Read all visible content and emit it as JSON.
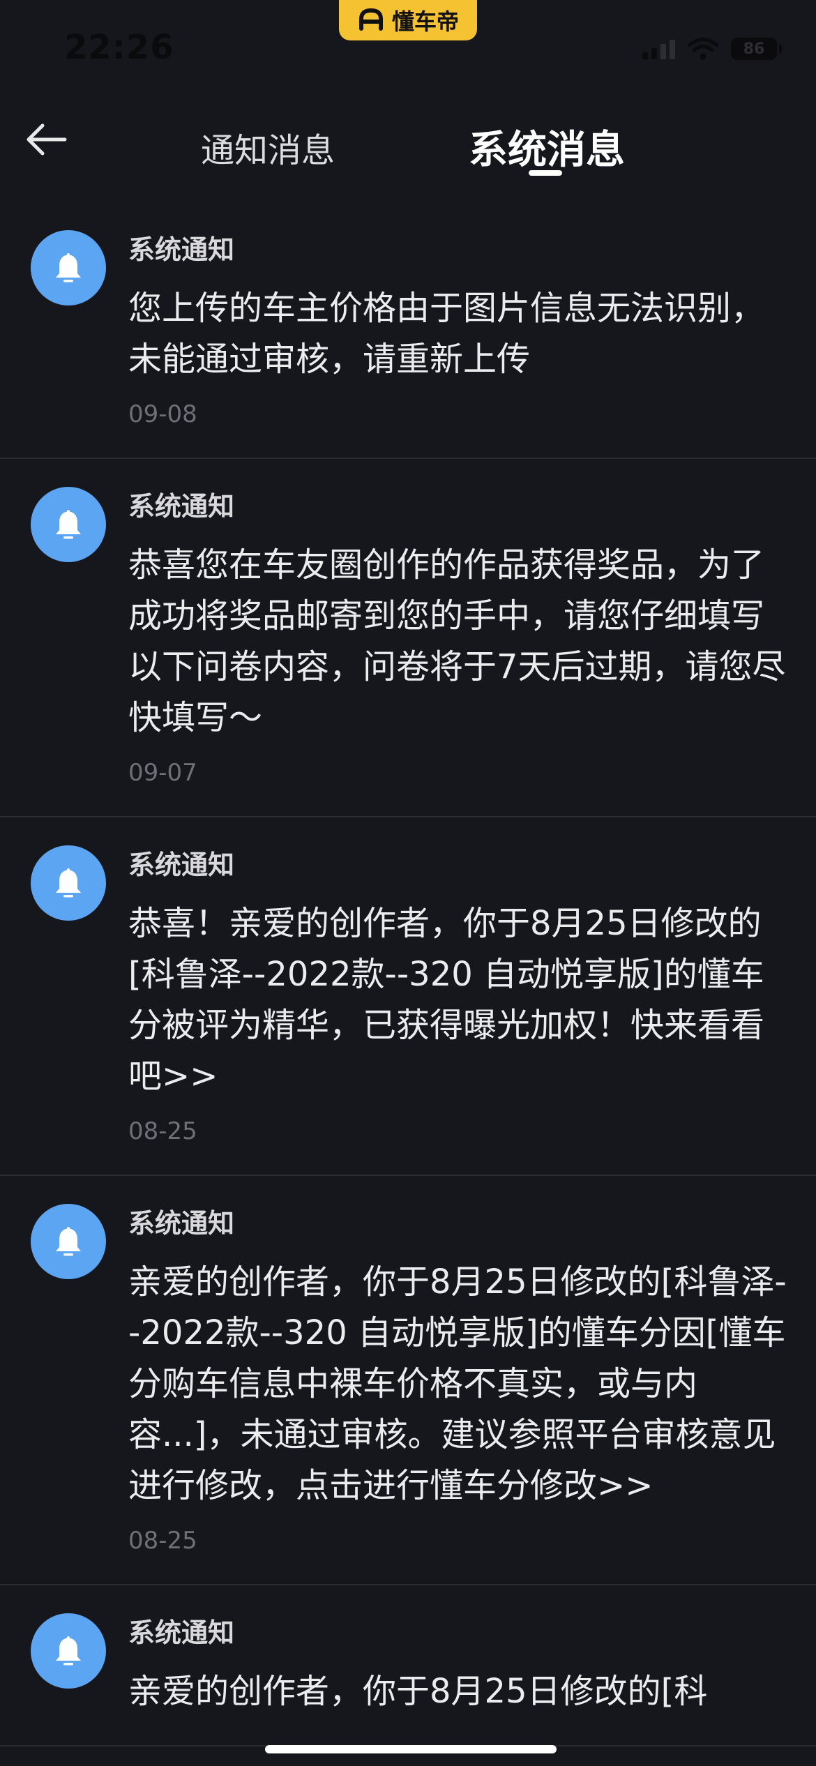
{
  "status_bar": {
    "time": "22:26",
    "battery": "86",
    "brand_name": "懂车帝"
  },
  "header": {
    "tabs": [
      {
        "label": "通知消息"
      },
      {
        "label": "系统消息"
      }
    ],
    "active_tab_index": 1,
    "icons": {
      "back": "arrow-left-icon"
    }
  },
  "messages": [
    {
      "title": "系统通知",
      "body": "您上传的车主价格由于图片信息无法识别，未能通过审核，请重新上传",
      "date": "09-08",
      "icon": "bell-icon"
    },
    {
      "title": "系统通知",
      "body": "恭喜您在车友圈创作的作品获得奖品，为了成功将奖品邮寄到您的手中，请您仔细填写以下问卷内容，问卷将于7天后过期，请您尽快填写～",
      "date": "09-07",
      "icon": "bell-icon"
    },
    {
      "title": "系统通知",
      "body": "恭喜！亲爱的创作者，你于8月25日修改的[科鲁泽--2022款--320 自动悦享版]的懂车分被评为精华，已获得曝光加权！快来看看吧>>",
      "date": "08-25",
      "icon": "bell-icon"
    },
    {
      "title": "系统通知",
      "body": "亲爱的创作者，你于8月25日修改的[科鲁泽--2022款--320 自动悦享版]的懂车分因[懂车分购车信息中裸车价格不真实，或与内容...]，未通过审核。建议参照平台审核意见进行修改，点击进行懂车分修改>>",
      "date": "08-25",
      "icon": "bell-icon"
    },
    {
      "title": "系统通知",
      "body": "亲爱的创作者，你于8月25日修改的[科",
      "date": "",
      "icon": "bell-icon"
    }
  ],
  "colors": {
    "background": "#16171c",
    "avatar": "#5ba5f2",
    "brand": "#f5c232",
    "divider": "#2a2b31",
    "date_text": "#6f7077"
  }
}
